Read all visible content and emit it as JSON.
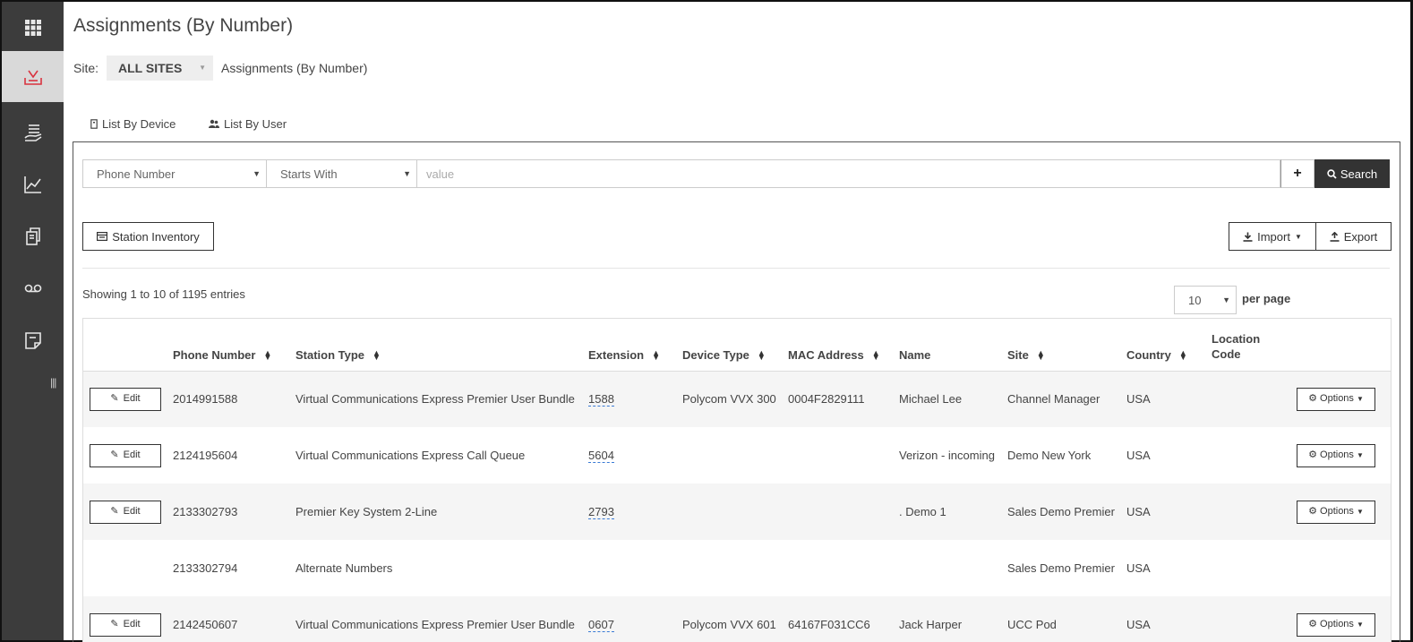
{
  "header": {
    "title": "Assignments (By Number)",
    "site_label": "Site:",
    "site_value": "ALL SITES",
    "breadcrumb": "Assignments (By Number)"
  },
  "tabs": [
    {
      "label": "List By Device"
    },
    {
      "label": "List By User"
    }
  ],
  "filter": {
    "field": "Phone Number",
    "operator": "Starts With",
    "value_placeholder": "value",
    "plus_label": "+",
    "search_label": "Search"
  },
  "actions": {
    "station_inventory": "Station Inventory",
    "import": "Import",
    "export": "Export"
  },
  "pagination": {
    "showing": "Showing 1 to 10 of 1195 entries",
    "per_page_value": "10",
    "per_page_label": "per page"
  },
  "table": {
    "headers": [
      "",
      "Phone Number",
      "Station Type",
      "Extension",
      "Device Type",
      "MAC Address",
      "Name",
      "Site",
      "Country",
      "Location Code",
      ""
    ],
    "edit_label": "Edit",
    "options_label": "Options",
    "rows": [
      {
        "has_edit": true,
        "phone": "2014991588",
        "station_type": "Virtual Communications Express Premier User Bundle",
        "extension": "1588",
        "device_type": "Polycom VVX 300",
        "mac": "0004F2829111",
        "name": "Michael Lee",
        "site": "Channel Manager",
        "country": "USA",
        "location": ""
      },
      {
        "has_edit": true,
        "phone": "2124195604",
        "station_type": "Virtual Communications Express Call Queue",
        "extension": "5604",
        "device_type": "",
        "mac": "",
        "name": "Verizon - incoming",
        "site": "Demo New York",
        "country": "USA",
        "location": ""
      },
      {
        "has_edit": true,
        "phone": "2133302793",
        "station_type": "Premier Key System 2-Line",
        "extension": "2793",
        "device_type": "",
        "mac": "",
        "name": ". Demo 1",
        "site": "Sales Demo Premier",
        "country": "USA",
        "location": ""
      },
      {
        "has_edit": false,
        "phone": "2133302794",
        "station_type": "Alternate Numbers",
        "extension": "",
        "device_type": "",
        "mac": "",
        "name": "",
        "site": "Sales Demo Premier",
        "country": "USA",
        "location": ""
      },
      {
        "has_edit": true,
        "phone": "2142450607",
        "station_type": "Virtual Communications Express Premier User Bundle",
        "extension": "0607",
        "device_type": "Polycom VVX 601",
        "mac": "64167F031CC6",
        "name": "Jack Harper",
        "site": "UCC Pod",
        "country": "USA",
        "location": ""
      }
    ]
  },
  "sidebar": {
    "items": [
      {
        "icon": "grid-icon"
      },
      {
        "icon": "inbox-download-icon"
      },
      {
        "icon": "hand-list-icon"
      },
      {
        "icon": "line-chart-icon"
      },
      {
        "icon": "copy-documents-icon"
      },
      {
        "icon": "voicemail-icon"
      },
      {
        "icon": "note-icon"
      }
    ]
  }
}
